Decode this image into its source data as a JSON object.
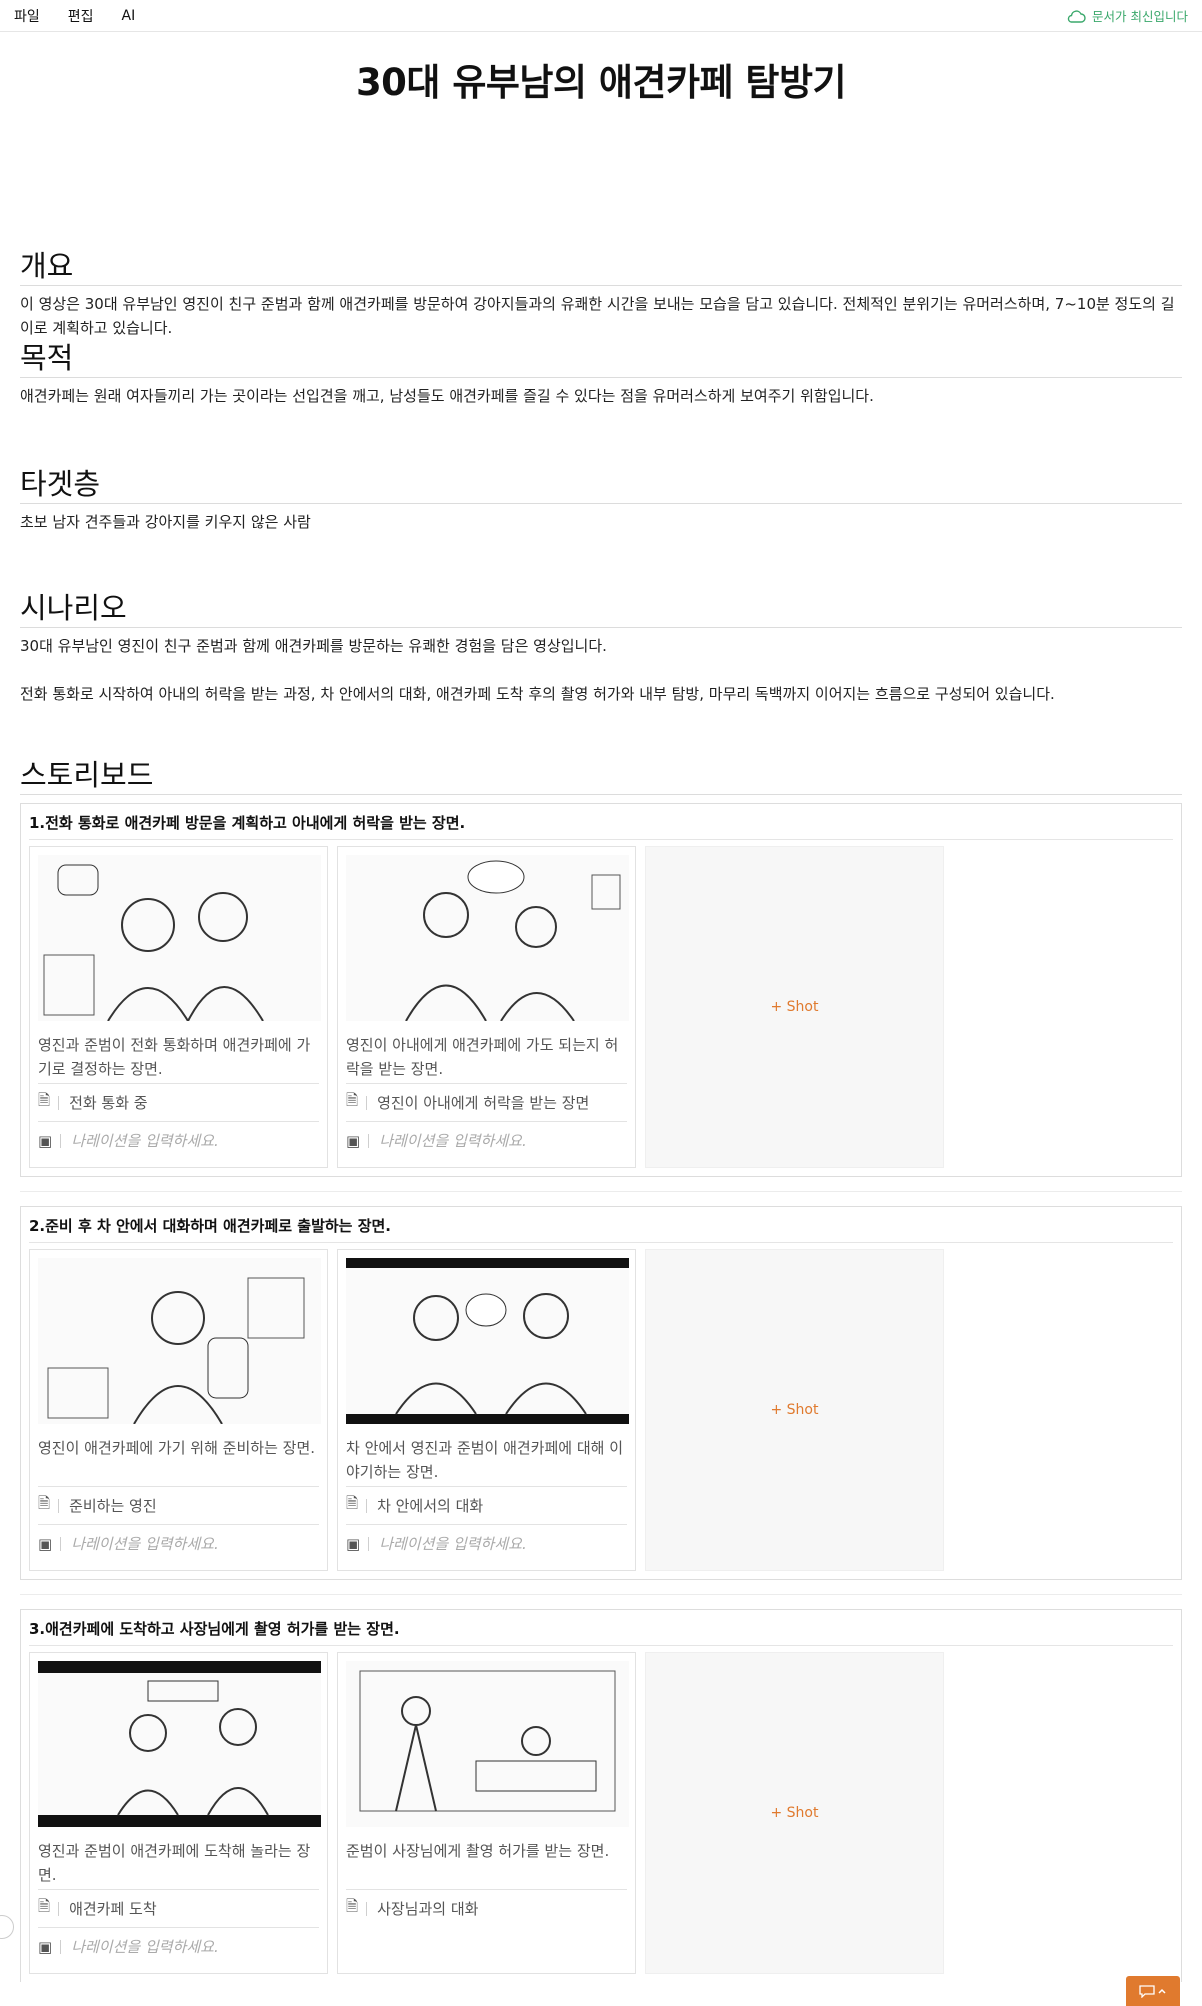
{
  "menu": {
    "items": [
      "파일",
      "편집",
      "AI"
    ],
    "status": "문서가 최신입니다"
  },
  "doc": {
    "title": "30대 유부남의 애견카페 탐방기",
    "overview": {
      "heading": "개요",
      "text": "이 영상은 30대 유부남인 영진이 친구 준범과 함께 애견카페를 방문하여 강아지들과의 유쾌한 시간을 보내는 모습을 담고 있습니다. 전체적인 분위기는 유머러스하며, 7~10분 정도의 길이로 계획하고 있습니다."
    },
    "purpose": {
      "heading": "목적",
      "text": "애견카페는 원래 여자들끼리 가는 곳이라는 선입견을 깨고, 남성들도 애견카페를 즐길 수 있다는 점을 유머러스하게 보여주기 위함입니다."
    },
    "target": {
      "heading": "타겟층",
      "text": "초보 남자 견주들과 강아지를 키우지 않은 사람"
    },
    "scenario": {
      "heading": "시나리오",
      "p1": "30대 유부남인 영진이 친구 준범과 함께 애견카페를 방문하는 유쾌한 경험을 담은 영상입니다.",
      "p2": "전화 통화로 시작하여 아내의 허락을 받는 과정, 차 안에서의 대화, 애견카페 도착 후의 촬영 허가와 내부 탐방, 마무리 독백까지 이어지는 흐름으로 구성되어 있습니다."
    },
    "storyboard": {
      "heading": "스토리보드",
      "add_label": "Shot",
      "narration_placeholder": "나레이션을 입력하세요.",
      "scenes": [
        {
          "title": "1.전화 통화로 애견카페 방문을 계획하고 아내에게 허락을 받는 장면.",
          "shots": [
            {
              "desc": "영진과 준범이 전화 통화하며 애견카페에 가기로 결정하는 장면.",
              "tag": "전화 통화 중"
            },
            {
              "desc": "영진이 아내에게 애견카페에 가도 되는지 허락을 받는 장면.",
              "tag": "영진이 아내에게 허락을 받는 장면"
            }
          ]
        },
        {
          "title": "2.준비 후 차 안에서 대화하며 애견카페로 출발하는 장면.",
          "shots": [
            {
              "desc": "영진이 애견카페에 가기 위해 준비하는 장면.",
              "tag": "준비하는 영진"
            },
            {
              "desc": "차 안에서 영진과 준범이 애견카페에 대해 이야기하는 장면.",
              "tag": "차 안에서의 대화"
            }
          ]
        },
        {
          "title": "3.애견카페에 도착하고 사장님에게 촬영 허가를 받는 장면.",
          "shots": [
            {
              "desc": "영진과 준범이 애견카페에 도착해 놀라는 장면.",
              "tag": "애견카페 도착"
            },
            {
              "desc": "준범이 사장님에게 촬영 허가를 받는 장면.",
              "tag": "사장님과의 대화"
            }
          ]
        }
      ]
    }
  }
}
